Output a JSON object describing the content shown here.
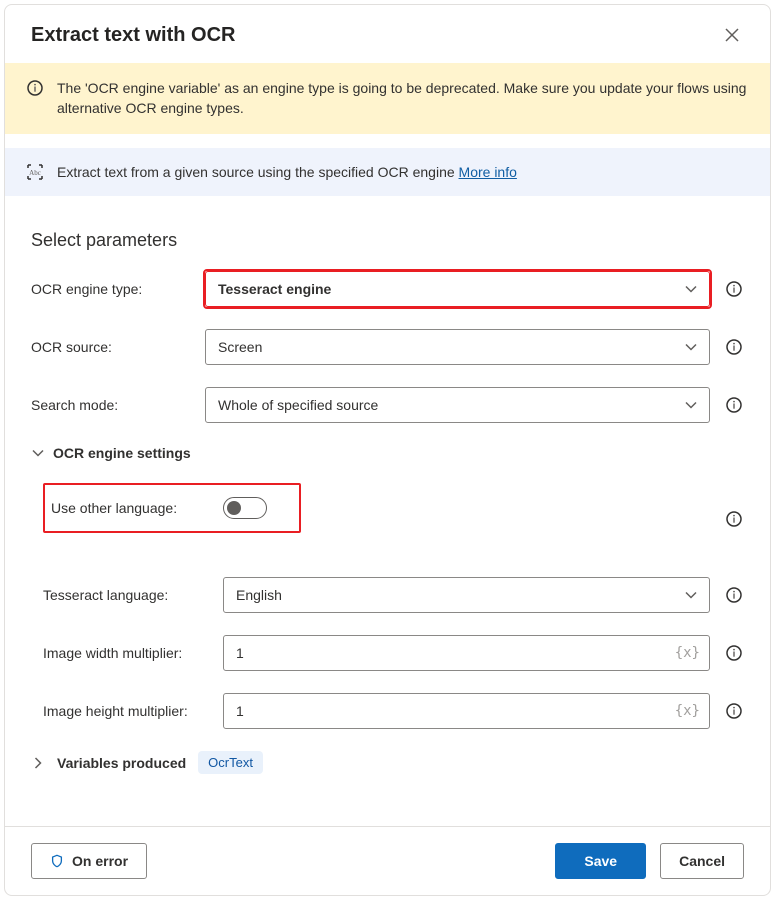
{
  "dialog": {
    "title": "Extract text with OCR"
  },
  "warning": {
    "message": "The 'OCR engine variable' as an engine type is going to be deprecated.  Make sure you update your flows using alternative OCR engine types."
  },
  "info": {
    "message": "Extract text from a given source using the specified OCR engine ",
    "more_info_label": "More info"
  },
  "section": {
    "heading": "Select parameters"
  },
  "fields": {
    "engine_type": {
      "label": "OCR engine type:",
      "value": "Tesseract engine"
    },
    "ocr_source": {
      "label": "OCR source:",
      "value": "Screen"
    },
    "search_mode": {
      "label": "Search mode:",
      "value": "Whole of specified source"
    }
  },
  "engine_settings": {
    "header": "OCR engine settings",
    "use_other_language": {
      "label": "Use other language:",
      "value": false
    },
    "tesseract_language": {
      "label": "Tesseract language:",
      "value": "English"
    },
    "width_multiplier": {
      "label": "Image width multiplier:",
      "value": "1",
      "hint": "{x}"
    },
    "height_multiplier": {
      "label": "Image height multiplier:",
      "value": "1",
      "hint": "{x}"
    }
  },
  "variables": {
    "label": "Variables produced",
    "value": "OcrText"
  },
  "footer": {
    "on_error": "On error",
    "save": "Save",
    "cancel": "Cancel"
  }
}
